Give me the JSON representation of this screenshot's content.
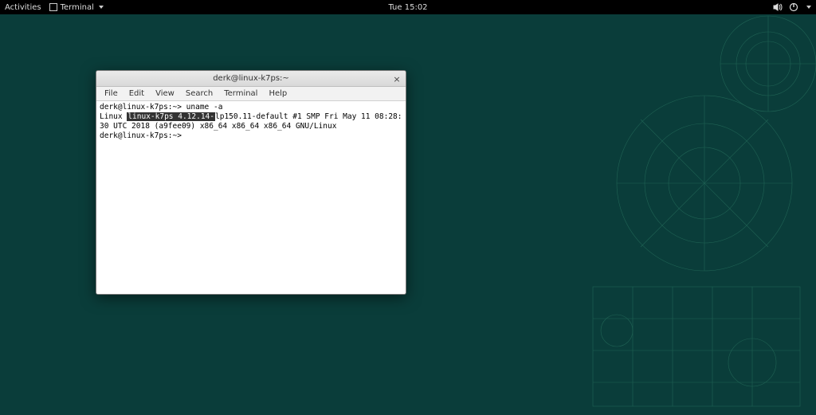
{
  "panel": {
    "activities": "Activities",
    "app_name": "Terminal",
    "clock": "Tue 15:02"
  },
  "window": {
    "title": "derk@linux-k7ps:~",
    "close_glyph": "×",
    "menus": [
      "File",
      "Edit",
      "View",
      "Search",
      "Terminal",
      "Help"
    ]
  },
  "terminal": {
    "line1_prompt": "derk@linux-k7ps:~> ",
    "line1_cmd": "uname -a",
    "line2_pre": "Linux ",
    "line2_hl": "linux-k7ps 4.12.14-",
    "line2_post": "lp150.11-default #1 SMP Fri May 11 08:28:30 UTC 2018 (a9fee09) x86_64 x86_64 x86_64 GNU/Linux",
    "line3": "derk@linux-k7ps:~> "
  }
}
